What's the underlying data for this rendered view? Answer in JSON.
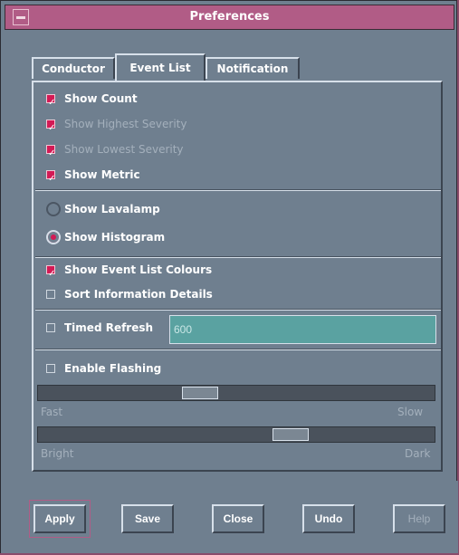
{
  "window": {
    "title": "Preferences"
  },
  "tabs": [
    {
      "label": "Conductor",
      "active": false
    },
    {
      "label": "Event List",
      "active": true
    },
    {
      "label": "Notification",
      "active": false
    }
  ],
  "event_list": {
    "show_count": {
      "label": "Show Count",
      "checked": true,
      "enabled": true
    },
    "show_highest_severity": {
      "label": "Show Highest Severity",
      "checked": true,
      "enabled": false
    },
    "show_lowest_severity": {
      "label": "Show Lowest Severity",
      "checked": true,
      "enabled": false
    },
    "show_metric": {
      "label": "Show Metric",
      "checked": true,
      "enabled": true
    },
    "radio_lavalamp": {
      "label": "Show Lavalamp",
      "selected": false
    },
    "radio_histogram": {
      "label": "Show Histogram",
      "selected": true
    },
    "show_event_list_colours": {
      "label": "Show Event List Colours",
      "checked": true
    },
    "sort_information_details": {
      "label": "Sort Information Details",
      "checked": false
    },
    "timed_refresh": {
      "label": "Timed Refresh",
      "checked": false,
      "value": "600"
    },
    "enable_flashing": {
      "label": "Enable Flashing",
      "checked": false
    },
    "speed": {
      "left_label": "Fast",
      "right_label": "Slow",
      "value": 0.4
    },
    "brightness": {
      "left_label": "Bright",
      "right_label": "Dark",
      "value": 0.65
    }
  },
  "buttons": {
    "apply": "Apply",
    "save": "Save",
    "close": "Close",
    "undo": "Undo",
    "help": "Help"
  },
  "colors": {
    "accent": "#d31a55",
    "title_bar": "#b15c86",
    "panel": "#6f7f8f",
    "input_bg": "#5aa2a1"
  }
}
